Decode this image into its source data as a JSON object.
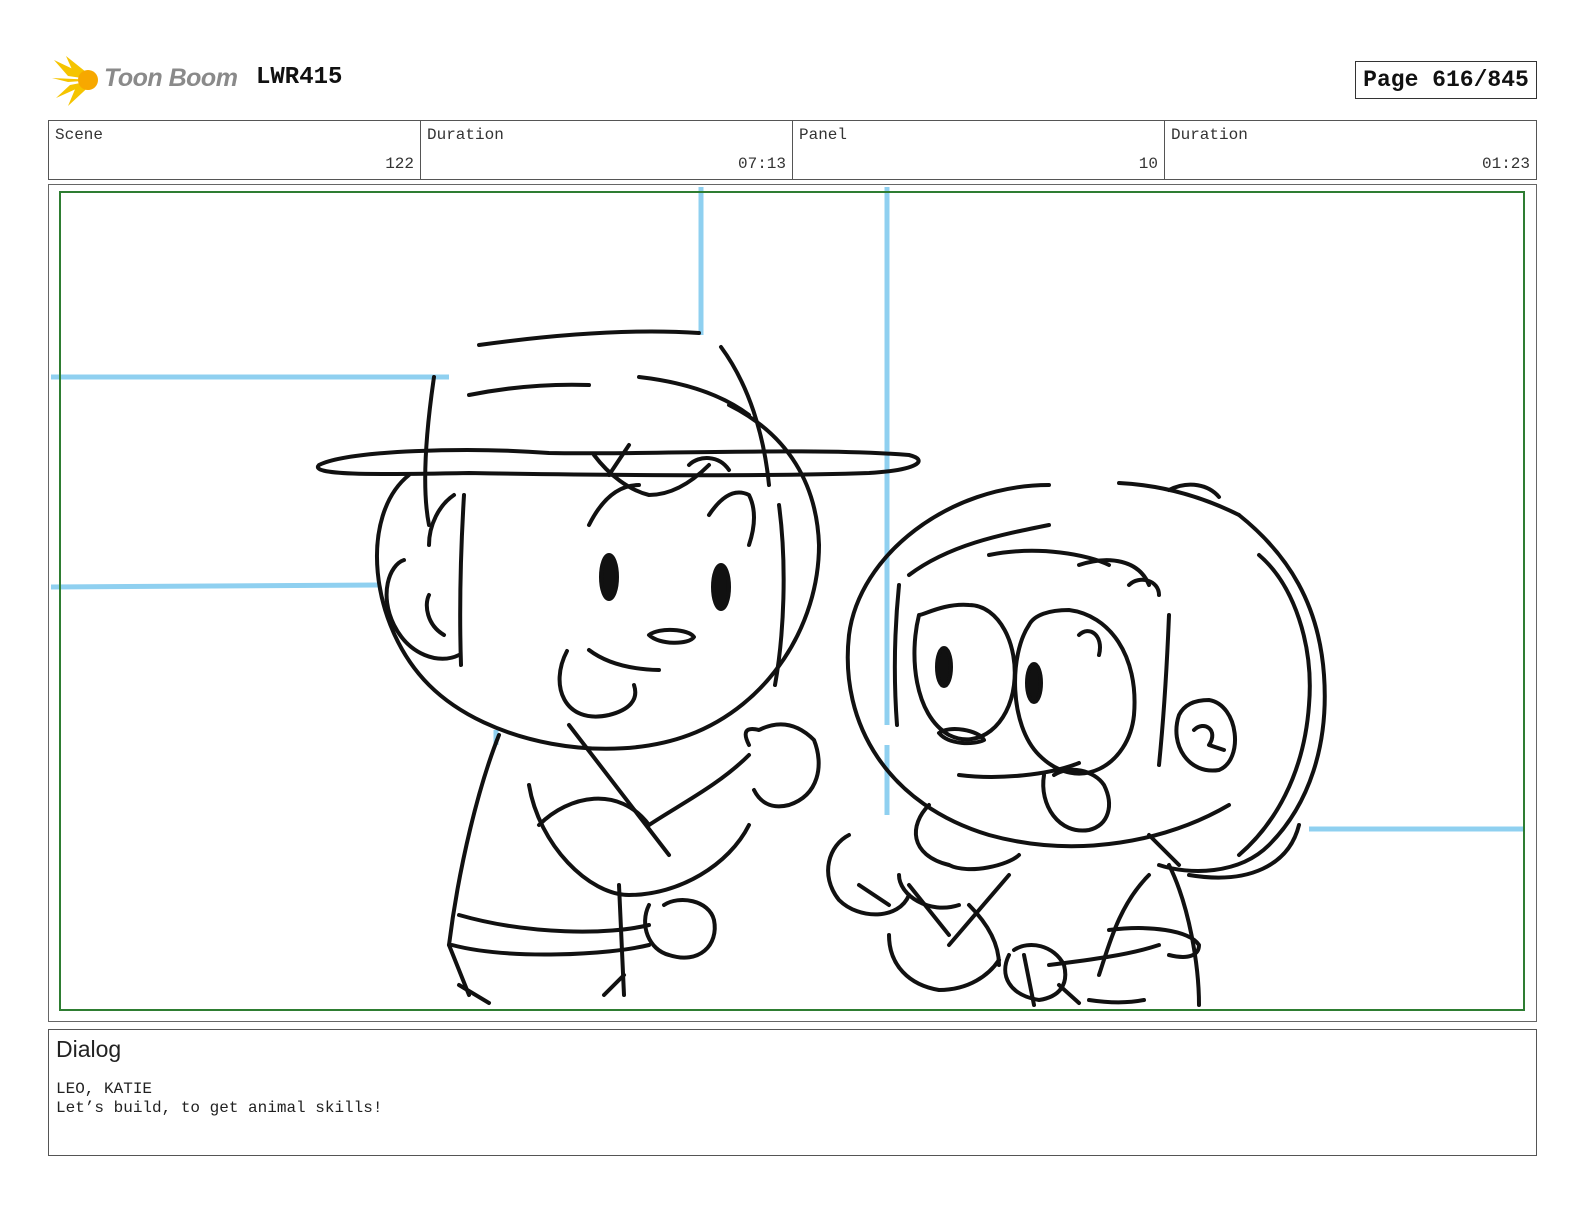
{
  "header": {
    "logo_text": "Toon Boom",
    "project_code": "LWR415",
    "page_label": "Page 616/845"
  },
  "info": {
    "scene": {
      "label": "Scene",
      "value": "122"
    },
    "scene_duration": {
      "label": "Duration",
      "value": "07:13"
    },
    "panel": {
      "label": "Panel",
      "value": "10"
    },
    "panel_duration": {
      "label": "Duration",
      "value": "01:23"
    }
  },
  "dialog": {
    "title": "Dialog",
    "speaker": "LEO, KATIE",
    "text": "Let’s build, to get animal skills!"
  },
  "colors": {
    "safe_frame": "#2e7d32",
    "guide_lines": "#8fd0f0",
    "ink": "#111111",
    "logo_yellow": "#f5c400"
  }
}
